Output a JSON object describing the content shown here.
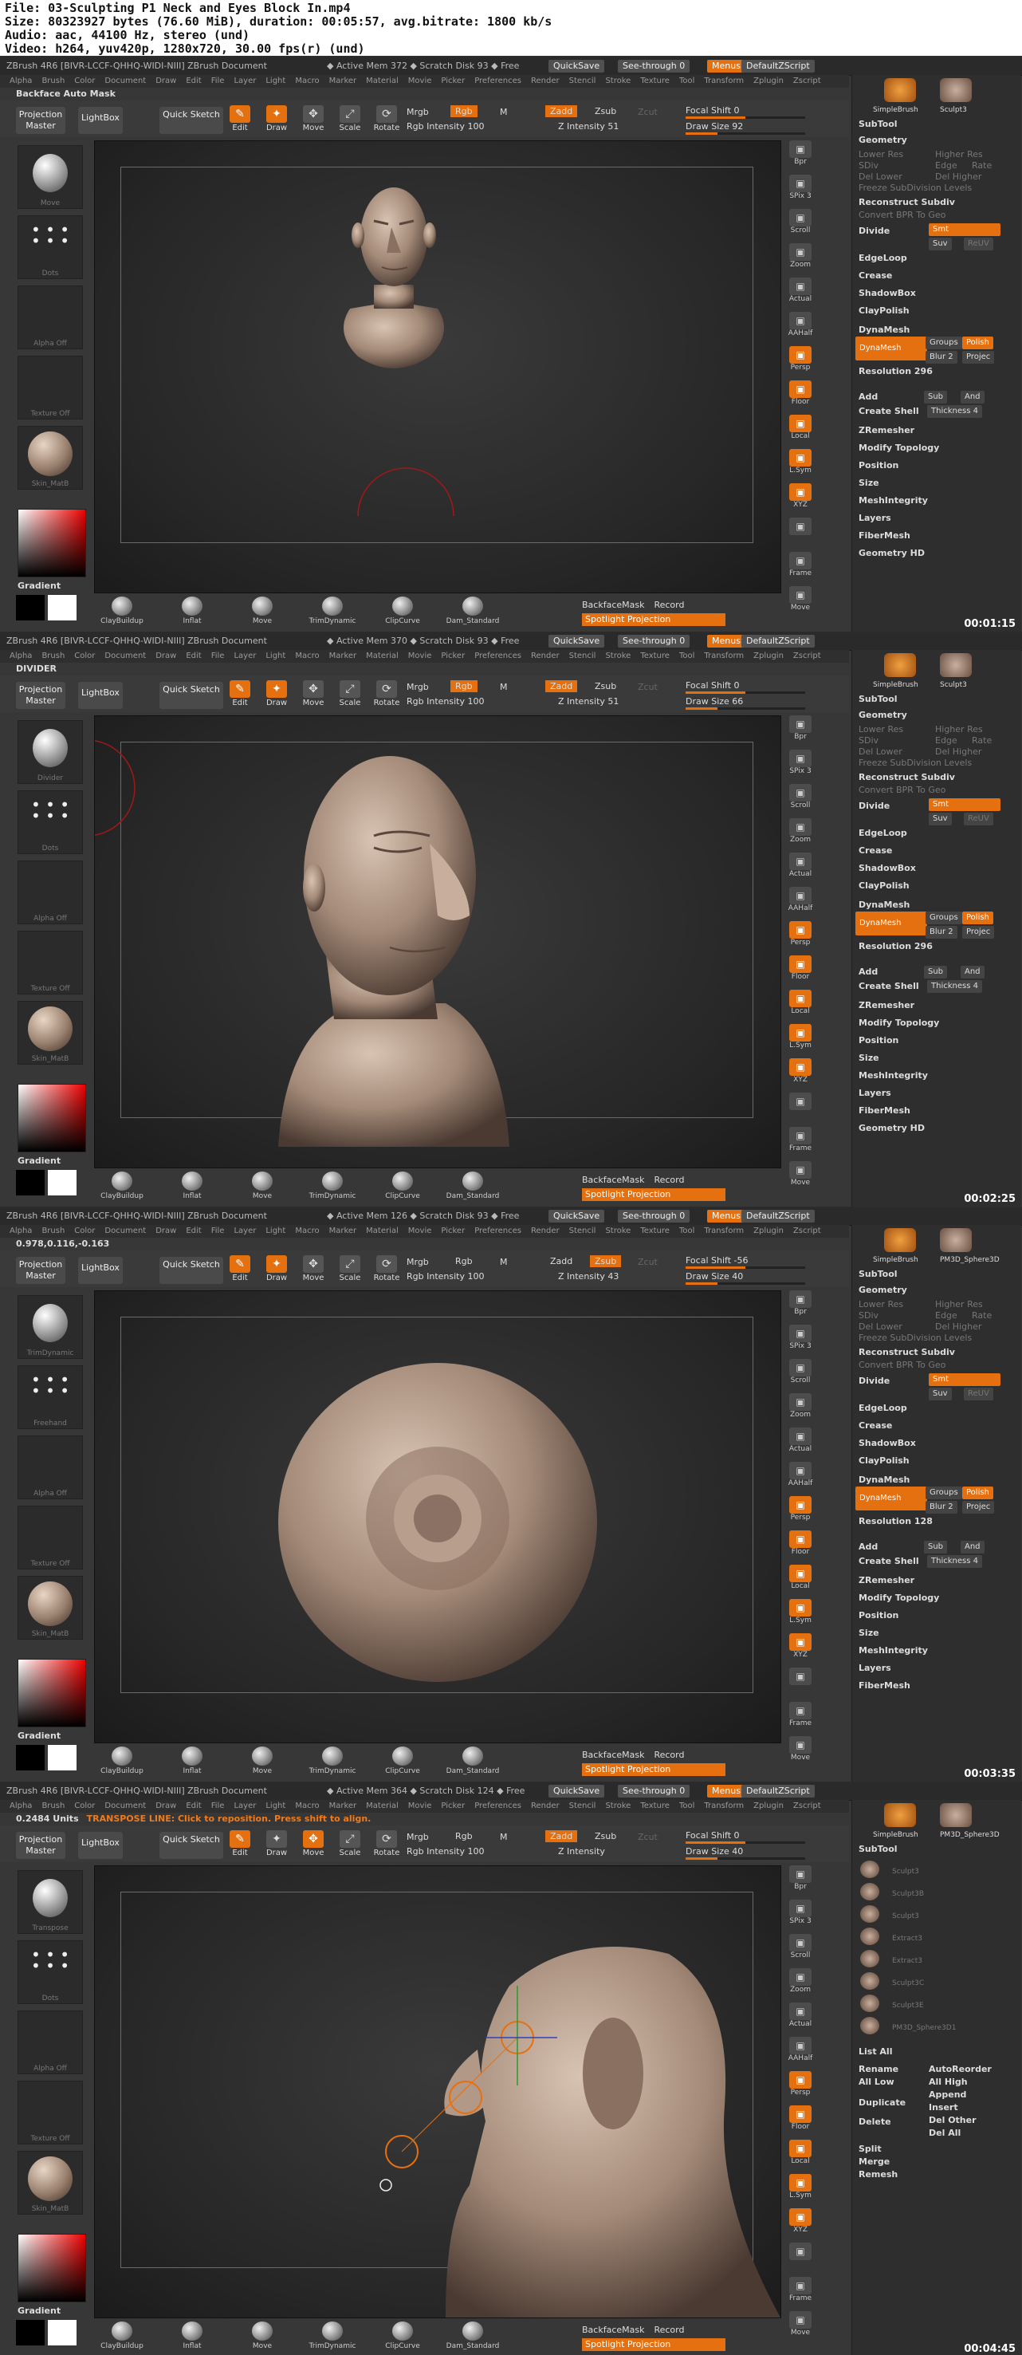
{
  "file_info": {
    "file": "File: 03-Sculpting P1 Neck and Eyes Block In.mp4",
    "size": "Size: 80323927 bytes (76.60 MiB), duration: 00:05:57, avg.bitrate: 1800 kb/s",
    "audio": "Audio: aac, 44100 Hz, stereo (und)",
    "video": "Video: h264, yuv420p, 1280x720, 30.00 fps(r) (und)"
  },
  "common": {
    "app_title_prefix": "ZBrush 4R6  [BIVR-LCCF-QHHQ-WIDI-NIII]   ZBrush Document",
    "quicksave": "QuickSave",
    "see_through": "See-through  0",
    "menus": "Menus",
    "default_zscript": "DefaultZScript",
    "menu_items": [
      "Alpha",
      "Brush",
      "Color",
      "Document",
      "Draw",
      "Edit",
      "File",
      "Layer",
      "Light",
      "Macro",
      "Marker",
      "Material",
      "Movie",
      "Picker",
      "Preferences",
      "Render",
      "Stencil",
      "Stroke",
      "Texture",
      "Tool",
      "Transform",
      "Zplugin",
      "Zscript"
    ],
    "projection_master": "Projection Master",
    "lightbox": "LightBox",
    "quick_sketch": "Quick Sketch",
    "edit": "Edit",
    "draw": "Draw",
    "move": "Move",
    "scale": "Scale",
    "rotate": "Rotate",
    "mrgb": "Mrgb",
    "rgb": "Rgb",
    "m": "M",
    "zadd": "Zadd",
    "zsub": "Zsub",
    "zcut": "Zcut",
    "rgb_intensity": "Rgb Intensity 100",
    "backface_mask": "BackfaceMask",
    "record": "Record",
    "spotlight_projection": "Spotlight Projection",
    "gradient": "Gradient",
    "bottom_brushes": [
      "ClayBuildup",
      "Inflat",
      "Move",
      "TrimDynamic",
      "ClipCurve",
      "Dam_Standard"
    ],
    "right_tools": [
      "Bpr",
      "SPix 3",
      "Scroll",
      "Zoom",
      "Actual",
      "AAHalf",
      "Persp",
      "Floor",
      "Local",
      "L.Sym",
      "XYZ",
      "",
      "Frame",
      "Move"
    ],
    "subtool": "SubTool",
    "geometry": "Geometry",
    "geometry_items": {
      "lower_res": "Lower Res",
      "higher_res": "Higher Res",
      "sdiv": "SDiv",
      "edge": "Edge",
      "rate": "Rate",
      "del_lower": "Del Lower",
      "del_higher": "Del Higher",
      "freeze": "Freeze SubDivision Levels",
      "reconstruct": "Reconstruct Subdiv",
      "convert_bpr": "Convert BPR To Geo",
      "divide": "Divide",
      "smt": "Smt",
      "suv": "Suv",
      "reuv": "ReUV",
      "edgeloop": "EdgeLoop",
      "crease": "Crease",
      "shadowbox": "ShadowBox",
      "claypolish": "ClayPolish",
      "dynamesh": "DynaMesh",
      "groups": "Groups",
      "polish": "Polish",
      "blur": "Blur 2",
      "project": "Projec",
      "add": "Add",
      "sub": "Sub",
      "and": "And",
      "create_shell": "Create Shell",
      "thickness": "Thickness 4",
      "zremesher": "ZRemesher",
      "modify_topology": "Modify Topology",
      "position": "Position",
      "size": "Size",
      "mesh_integrity": "MeshIntegrity"
    },
    "layers": "Layers",
    "fibermesh": "FiberMesh",
    "geometry_hd": "Geometry HD",
    "simple_brush": "SimpleBrush"
  },
  "frames": [
    {
      "time": "00:01:15",
      "active_mem": "◆ Active Mem 372 ◆ Scratch Disk 93 ◆ Free",
      "notice": "Backface Auto Mask",
      "notice_detail": "",
      "focal_shift": "Focal Shift 0",
      "z_intensity": "Z Intensity 51",
      "draw_size": "Draw Size 92",
      "resolution": "Resolution 296",
      "left_items": [
        "Move",
        "Dots",
        "Alpha Off",
        "Texture Off",
        "Skin_MatB"
      ],
      "subtool_thumbs": [
        "SimpleBrush",
        "Sculpt3"
      ],
      "scene": "bust-front"
    },
    {
      "time": "00:02:25",
      "active_mem": "◆ Active Mem 370 ◆ Scratch Disk 93 ◆ Free",
      "notice": "DIVIDER",
      "notice_detail": "",
      "focal_shift": "Focal Shift 0",
      "z_intensity": "Z Intensity 51",
      "draw_size": "Draw Size 66",
      "resolution": "Resolution 296",
      "left_items": [
        "Divider",
        "Dots",
        "Alpha Off",
        "Texture Off",
        "Skin_MatB"
      ],
      "subtool_thumbs": [
        "SimpleBrush",
        "Sculpt3"
      ],
      "scene": "bust-3q"
    },
    {
      "time": "00:03:35",
      "active_mem": "◆ Active Mem 126 ◆ Scratch Disk 93 ◆ Free",
      "notice": "0.978,0.116,-0.163",
      "notice_detail": "",
      "focal_shift": "Focal Shift -56",
      "z_intensity": "Z Intensity 43",
      "draw_size": "Draw Size 40",
      "resolution": "Resolution 128",
      "left_items": [
        "TrimDynamic",
        "Freehand",
        "Alpha Off",
        "Texture Off",
        "Skin_MatB"
      ],
      "subtool_thumbs": [
        "SimpleBrush",
        "PM3D_Sphere3D"
      ],
      "scene": "eye"
    },
    {
      "time": "00:04:45",
      "active_mem": "◆ Active Mem 364 ◆ Scratch Disk 124 ◆ Free",
      "notice": "0.2484 Units",
      "notice_detail": "TRANSPOSE LINE: Click to reposition. Press shift to align.",
      "focal_shift": "Focal Shift 0",
      "z_intensity": "Z Intensity",
      "draw_size": "Draw Size 40",
      "resolution": "",
      "left_items": [
        "Transpose",
        "Dots",
        "Alpha Off",
        "Texture Off",
        "Skin_MatB"
      ],
      "subtool_thumbs": [
        "SimpleBrush",
        "PM3D_Sphere3D"
      ],
      "subtool_list": [
        "Sculpt3",
        "Sculpt3B",
        "Sculpt3",
        "Extract3",
        "Extract3",
        "Sculpt3C",
        "Sculpt3E",
        "PM3D_Sphere3D1"
      ],
      "list_actions": [
        "List All",
        "Rename",
        "AutoReorder",
        "All Low",
        "All High",
        "Duplicate",
        "Append",
        "Insert",
        "Delete",
        "Del Other",
        "Del All",
        "Split",
        "Merge",
        "Remesh"
      ],
      "scene": "side"
    }
  ]
}
